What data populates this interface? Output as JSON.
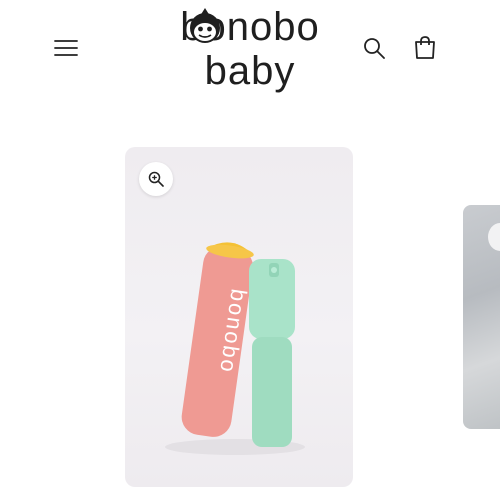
{
  "header": {
    "logo": {
      "line1": "bonobo",
      "line2": "baby",
      "color": "#1f1f1f"
    },
    "icons": {
      "menu": "hamburger-menu-icon",
      "search": "search-icon",
      "cart": "cart-bag-icon"
    }
  },
  "gallery": {
    "zoom_icon": "zoom-in-icon",
    "main_media": {
      "product_colors": {
        "pink": "#ef9a93",
        "mint": "#a9e3c9",
        "yellow": "#f4c135"
      },
      "bottle_brand_text": "bonobo"
    }
  }
}
